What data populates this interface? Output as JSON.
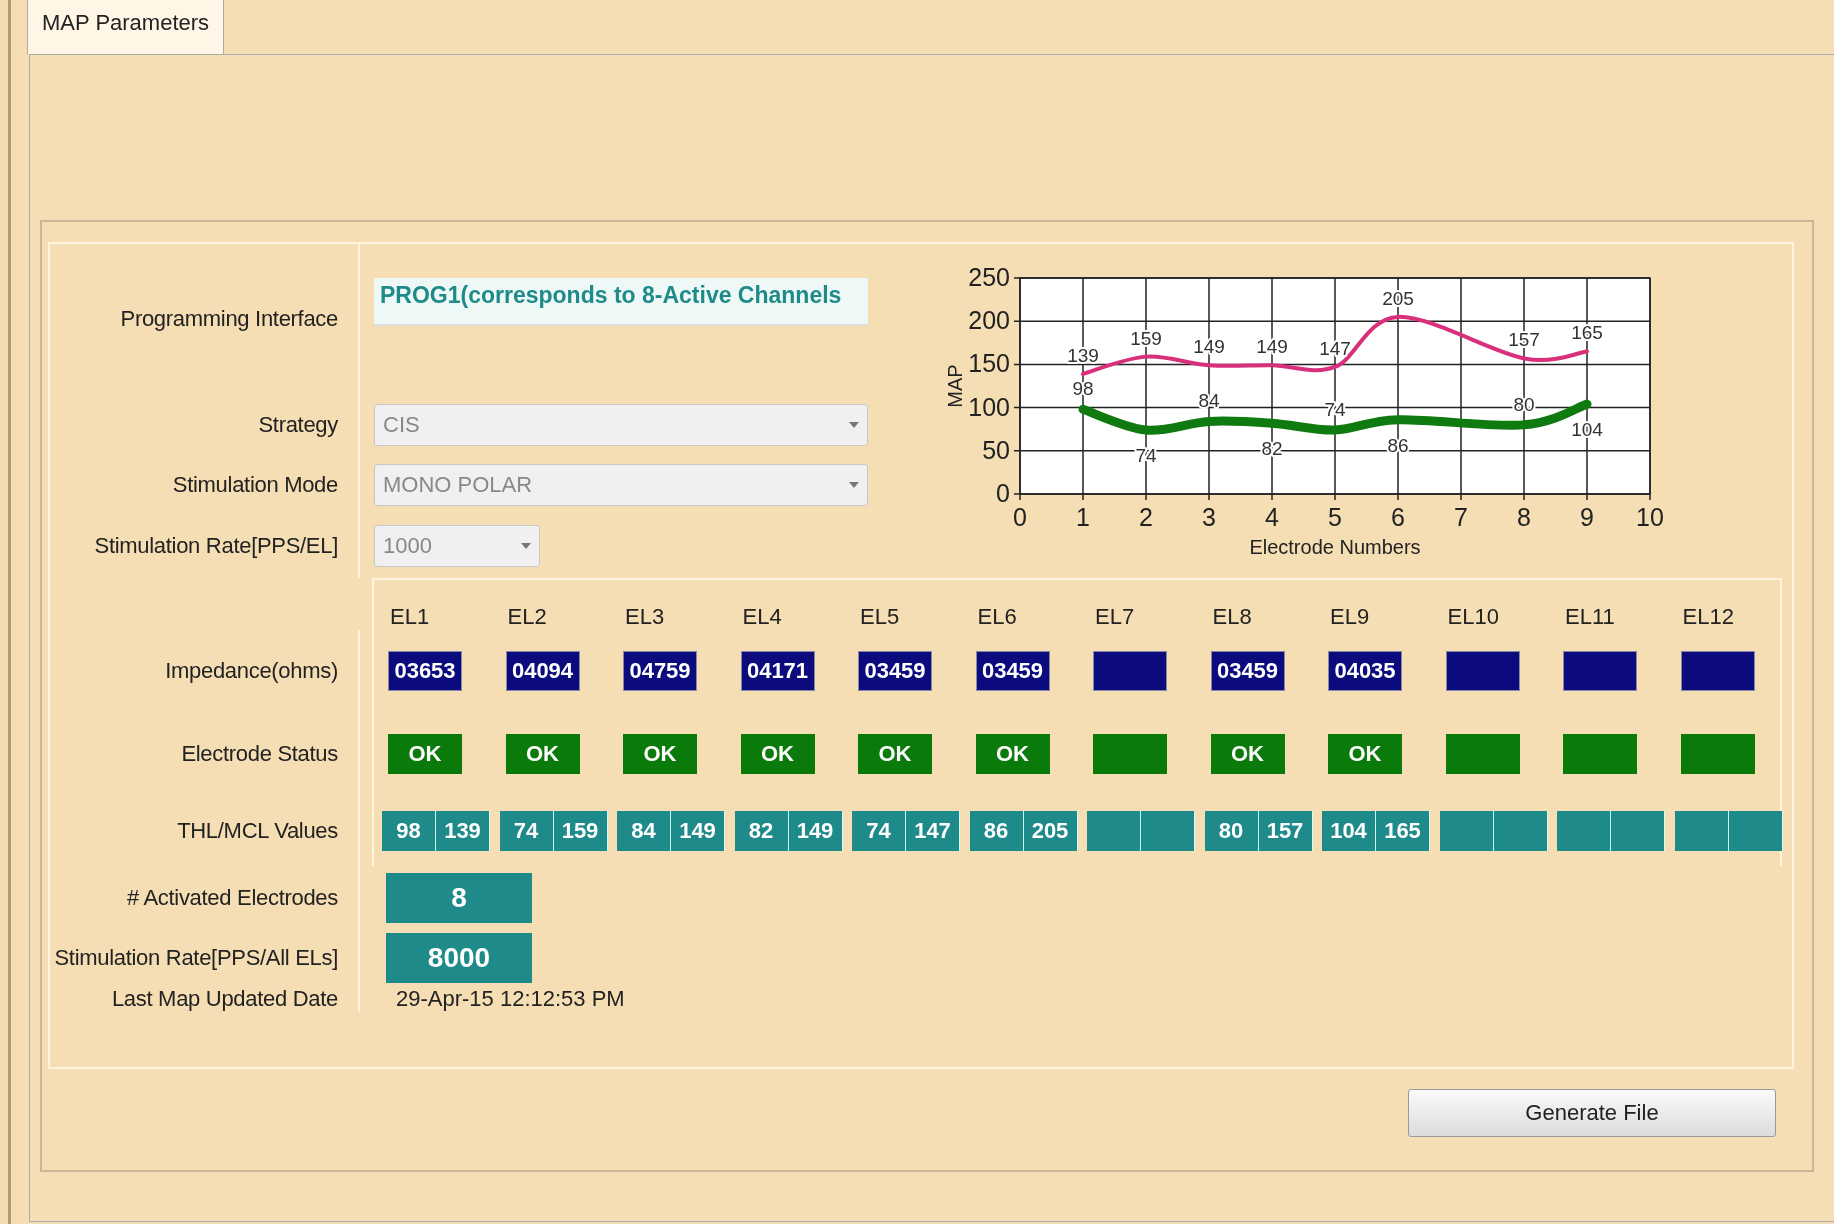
{
  "tabs": [
    {
      "label": "MAP Parameters",
      "selected": true
    }
  ],
  "form": {
    "programming_interface": {
      "label": "Programming Interface",
      "value": "PROG1(corresponds to 8-Active Channels"
    },
    "strategy": {
      "label": "Strategy",
      "value": "CIS",
      "disabled": true
    },
    "stimulation_mode": {
      "label": "Stimulation Mode",
      "value": "MONO POLAR",
      "disabled": true
    },
    "stimulation_rate": {
      "label": "Stimulation Rate[PPS/EL]",
      "value": "1000",
      "disabled": true
    }
  },
  "chart_data": {
    "type": "line",
    "xlabel": "Electrode Numbers",
    "ylabel": "MAP",
    "x": [
      1,
      2,
      3,
      4,
      5,
      6,
      8,
      9
    ],
    "xlim": [
      0,
      10
    ],
    "ylim": [
      0,
      250
    ],
    "xticks": [
      0,
      1,
      2,
      3,
      4,
      5,
      6,
      7,
      8,
      9,
      10
    ],
    "yticks": [
      0,
      50,
      100,
      150,
      200,
      250
    ],
    "data_labels": true,
    "grid": true,
    "series": [
      {
        "color": "#d8307a",
        "values": [
          139,
          159,
          149,
          149,
          147,
          205,
          157,
          165
        ]
      },
      {
        "color": "#0f7a0f",
        "values": [
          98,
          74,
          84,
          82,
          74,
          86,
          80,
          104
        ]
      }
    ]
  },
  "electrode_rows": {
    "impedance_label": "Impedance(ohms)",
    "status_label": "Electrode Status",
    "values_label": "THL/MCL Values"
  },
  "electrodes": [
    {
      "label": "EL1",
      "impedance": "03653",
      "status": "OK",
      "thl": "98",
      "mcl": "139"
    },
    {
      "label": "EL2",
      "impedance": "04094",
      "status": "OK",
      "thl": "74",
      "mcl": "159"
    },
    {
      "label": "EL3",
      "impedance": "04759",
      "status": "OK",
      "thl": "84",
      "mcl": "149"
    },
    {
      "label": "EL4",
      "impedance": "04171",
      "status": "OK",
      "thl": "82",
      "mcl": "149"
    },
    {
      "label": "EL5",
      "impedance": "03459",
      "status": "OK",
      "thl": "74",
      "mcl": "147"
    },
    {
      "label": "EL6",
      "impedance": "03459",
      "status": "OK",
      "thl": "86",
      "mcl": "205"
    },
    {
      "label": "EL7"
    },
    {
      "label": "EL8",
      "impedance": "03459",
      "status": "OK",
      "thl": "80",
      "mcl": "157"
    },
    {
      "label": "EL9",
      "impedance": "04035",
      "status": "OK",
      "thl": "104",
      "mcl": "165"
    },
    {
      "label": "EL10"
    },
    {
      "label": "EL11"
    },
    {
      "label": "EL12"
    }
  ],
  "activated_electrodes": {
    "label": "# Activated Electrodes",
    "value": "8"
  },
  "total_rate": {
    "label": "Stimulation Rate[PPS/All ELs]",
    "value": "8000"
  },
  "last_updated": {
    "label": "Last Map Updated Date",
    "value": "29-Apr-15 12:12:53 PM"
  },
  "buttons": [
    {
      "label": "Generate File"
    }
  ]
}
